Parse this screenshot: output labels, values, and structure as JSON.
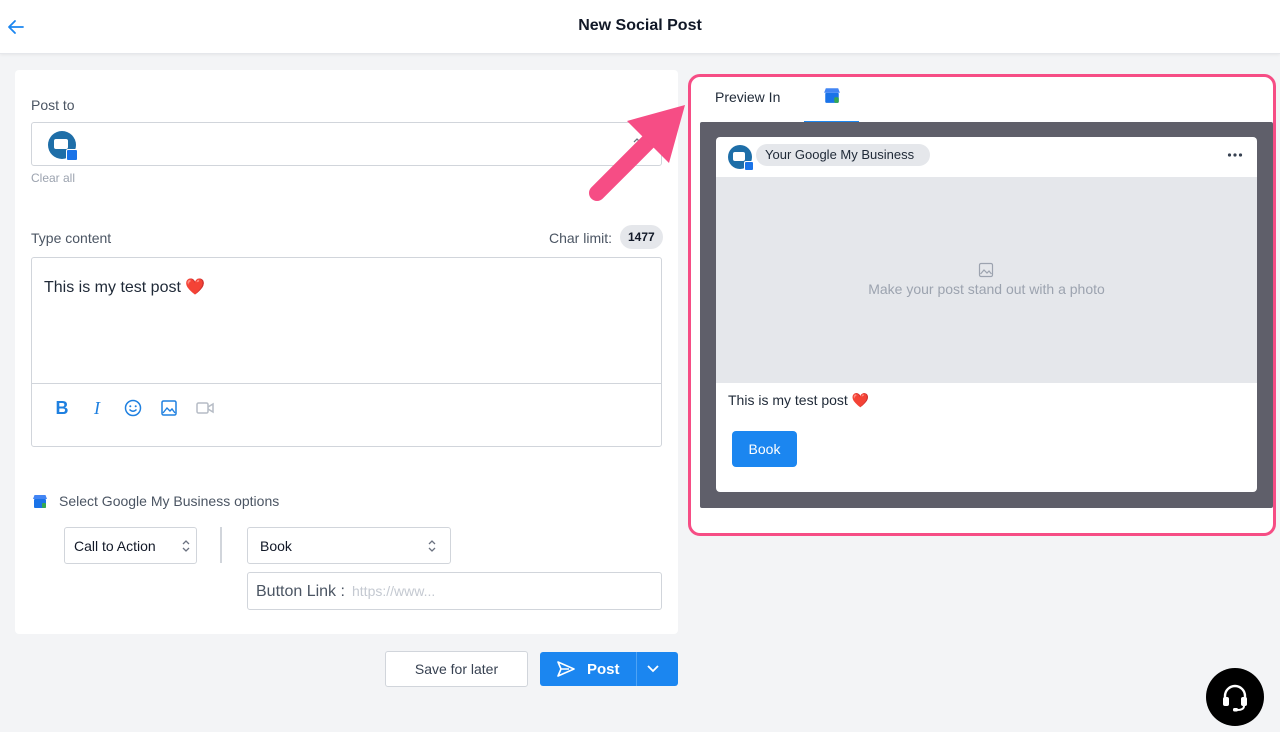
{
  "header": {
    "title": "New Social Post"
  },
  "compose": {
    "post_to_label": "Post to",
    "clear_all": "Clear all",
    "type_content_label": "Type content",
    "char_limit_label": "Char limit:",
    "char_limit_value": "1477",
    "content": "This is my test post",
    "content_emoji": "❤️"
  },
  "gmb_options": {
    "title": "Select Google My Business options",
    "type_select": "Call to Action",
    "action_select": "Book",
    "button_link_label": "Button Link :",
    "button_link_placeholder": "https://www..."
  },
  "actions": {
    "save_label": "Save for later",
    "post_label": "Post"
  },
  "preview": {
    "label": "Preview In",
    "account_name": "Your Google My Business",
    "photo_hint": "Make your post stand out with a photo",
    "post_text": "This is my test post",
    "post_emoji": "❤️",
    "button_label": "Book"
  },
  "colors": {
    "primary": "#1b86f0",
    "highlight": "#f64d85",
    "preview_bg": "#5f5f6a",
    "page_bg": "#f3f4f6"
  }
}
